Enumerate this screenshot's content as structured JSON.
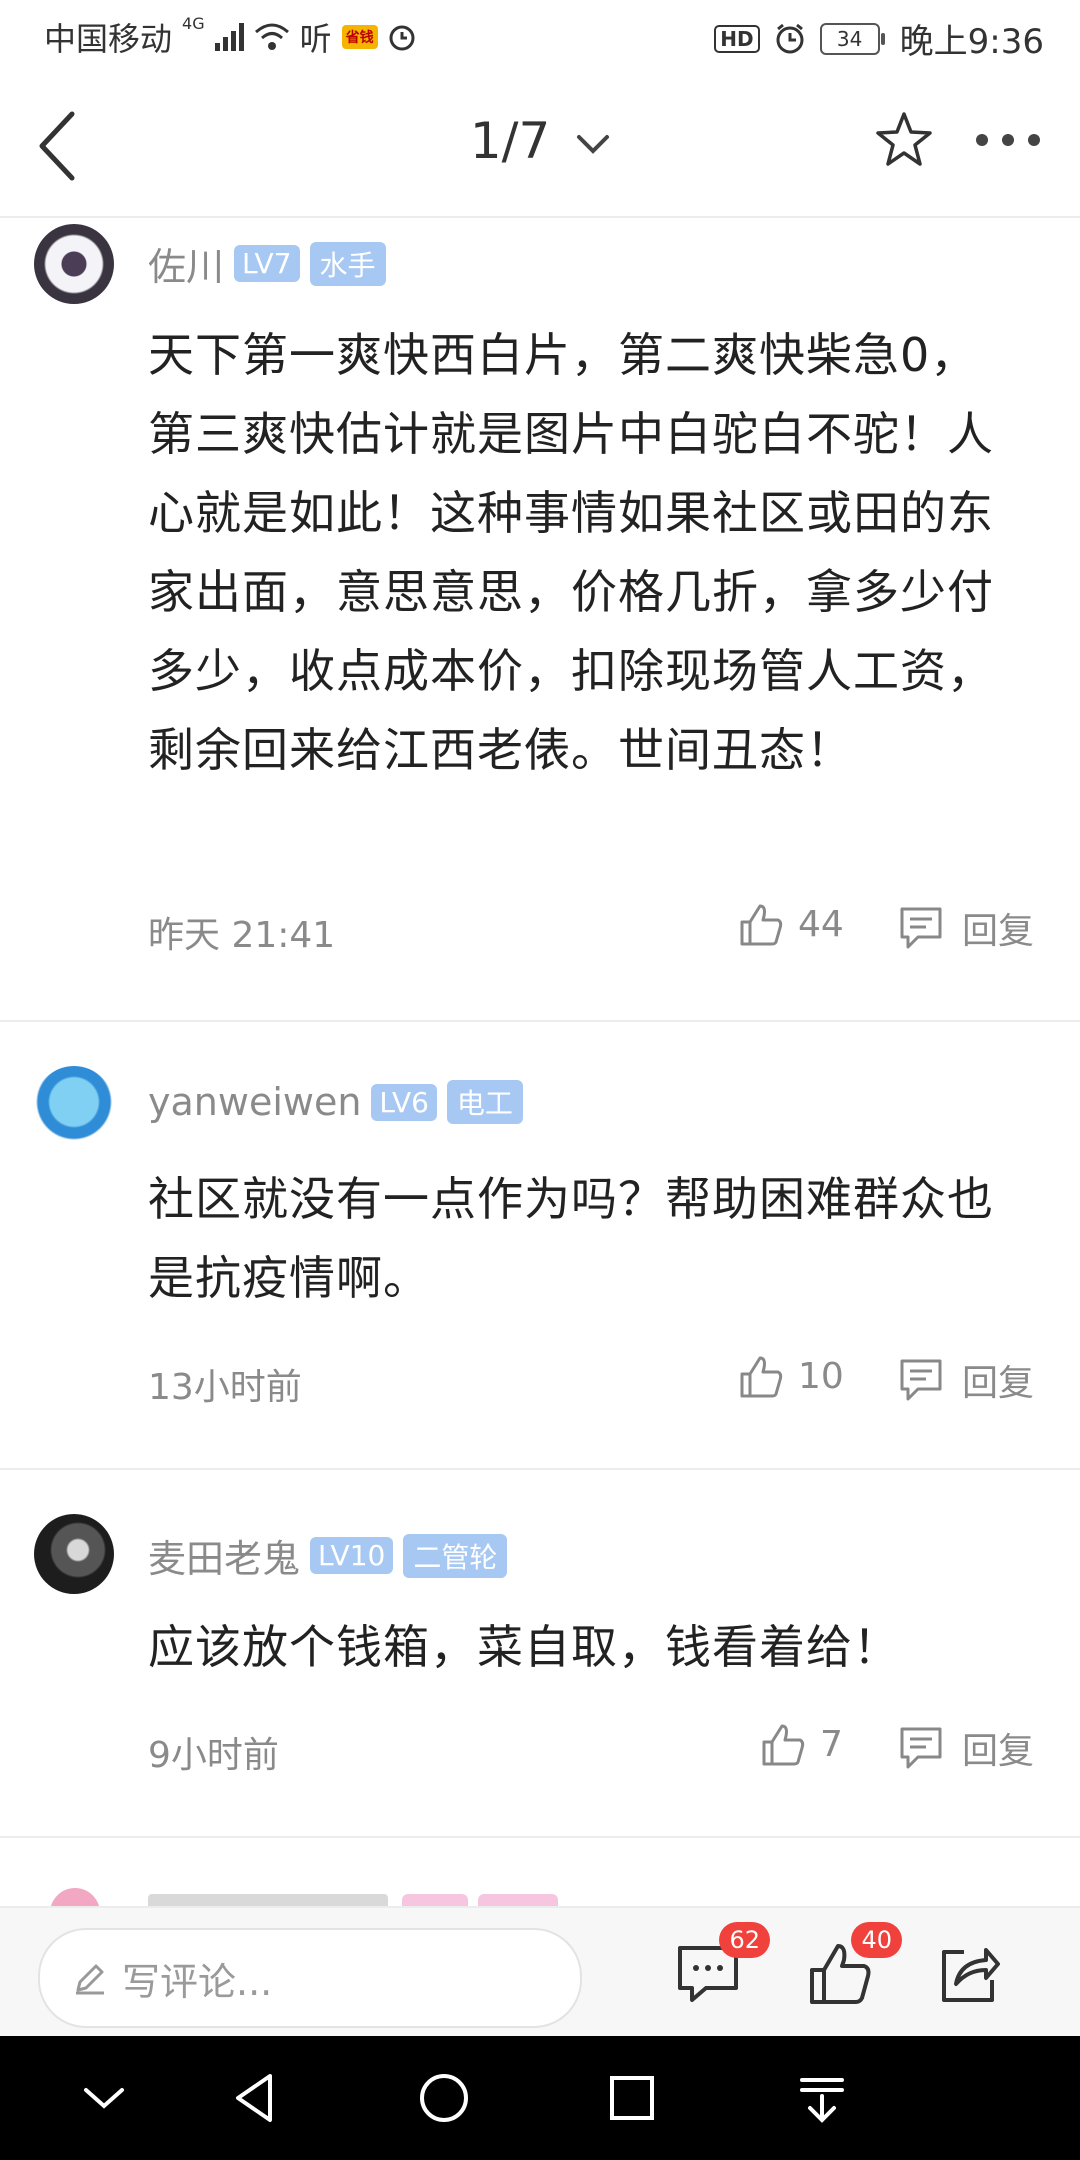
{
  "status": {
    "carrier": "中国移动",
    "network": "4G",
    "app_label": "听",
    "promo_badge": "省钱",
    "hd": "HD",
    "battery": "34",
    "time": "晚上9:36"
  },
  "nav": {
    "page_indicator": "1/7"
  },
  "comments": [
    {
      "user": "佐川",
      "level": "LV7",
      "role": "水手",
      "text": "天下第一爽快西白片，第二爽快柴急0，第三爽快估计就是图片中白驼白不驼！人心就是如此！这种事情如果社区或田的东家出面，意思意思，价格几折，拿多少付多少，收点成本价，扣除现场管人工资，剩余回来给江西老俵。世间丑态！",
      "time": "昨天 21:41",
      "likes": "44",
      "reply_label": "回复"
    },
    {
      "user": "yanweiwen",
      "level": "LV6",
      "role": "电工",
      "text": "社区就没有一点作为吗？帮助困难群众也是抗疫情啊。",
      "time": "13小时前",
      "likes": "10",
      "reply_label": "回复"
    },
    {
      "user": "麦田老鬼",
      "level": "LV10",
      "role": "二管轮",
      "text": "应该放个钱箱，菜自取，钱看着给！",
      "time": "9小时前",
      "likes": "7",
      "reply_label": "回复"
    }
  ],
  "bottom": {
    "comment_placeholder": "写评论...",
    "comment_count": "62",
    "like_count": "40"
  },
  "colors": {
    "tag_bg": "#a7c8f2",
    "badge_red": "#f0413c",
    "meta_gray": "#8a8a8a"
  }
}
